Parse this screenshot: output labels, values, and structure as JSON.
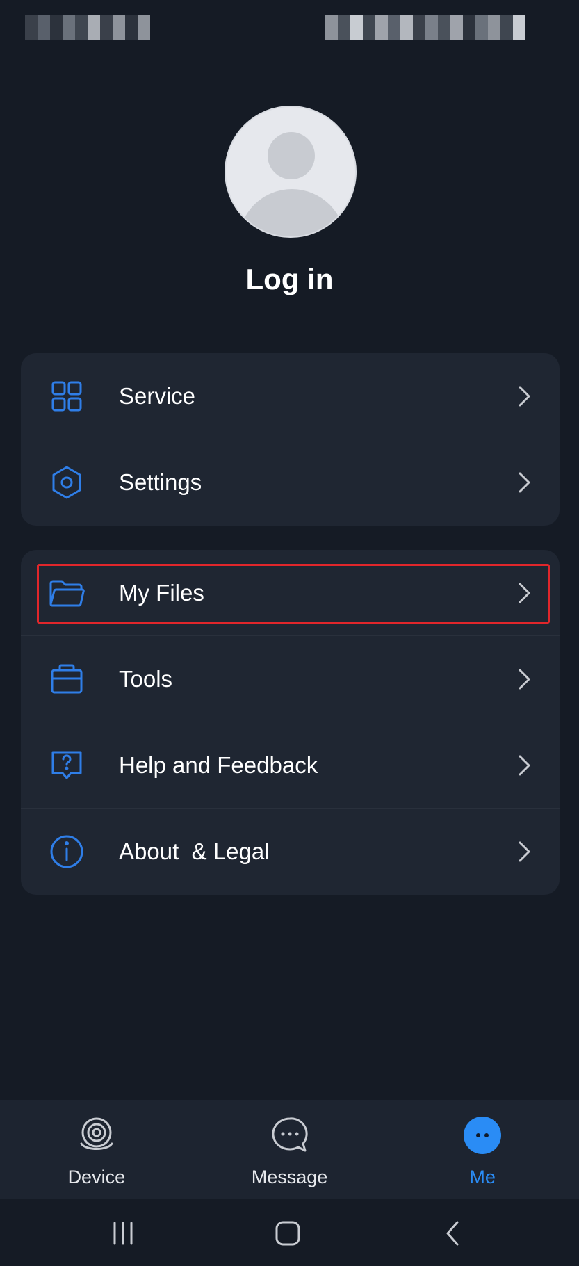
{
  "colors": {
    "background": "#151b25",
    "card": "#1f2632",
    "accent": "#2a8cf5",
    "icon_blue": "#2f7ee8",
    "highlight": "#e0262b",
    "text": "#ffffff",
    "chevron": "#c9ccd2"
  },
  "profile": {
    "avatar_icon": "default-avatar-icon",
    "login_label": "Log in"
  },
  "menu_group_1": [
    {
      "label": "Service",
      "icon": "grid-icon"
    },
    {
      "label": "Settings",
      "icon": "hexagon-settings-icon"
    }
  ],
  "menu_group_2": [
    {
      "label": "My Files",
      "icon": "folder-icon"
    },
    {
      "label": "Tools",
      "icon": "toolbox-icon"
    },
    {
      "label": "Help and Feedback",
      "icon": "help-bubble-icon"
    },
    {
      "label": "About  & Legal",
      "icon": "info-icon"
    }
  ],
  "tabbar": {
    "tabs": [
      {
        "label": "Device",
        "icon": "camera-device-icon",
        "active": false
      },
      {
        "label": "Message",
        "icon": "chat-bubble-icon",
        "active": false
      },
      {
        "label": "Me",
        "icon": "me-dots-icon",
        "active": true
      }
    ]
  },
  "system_nav": {
    "recents": "recents-icon",
    "home": "home-icon",
    "back": "back-icon"
  }
}
